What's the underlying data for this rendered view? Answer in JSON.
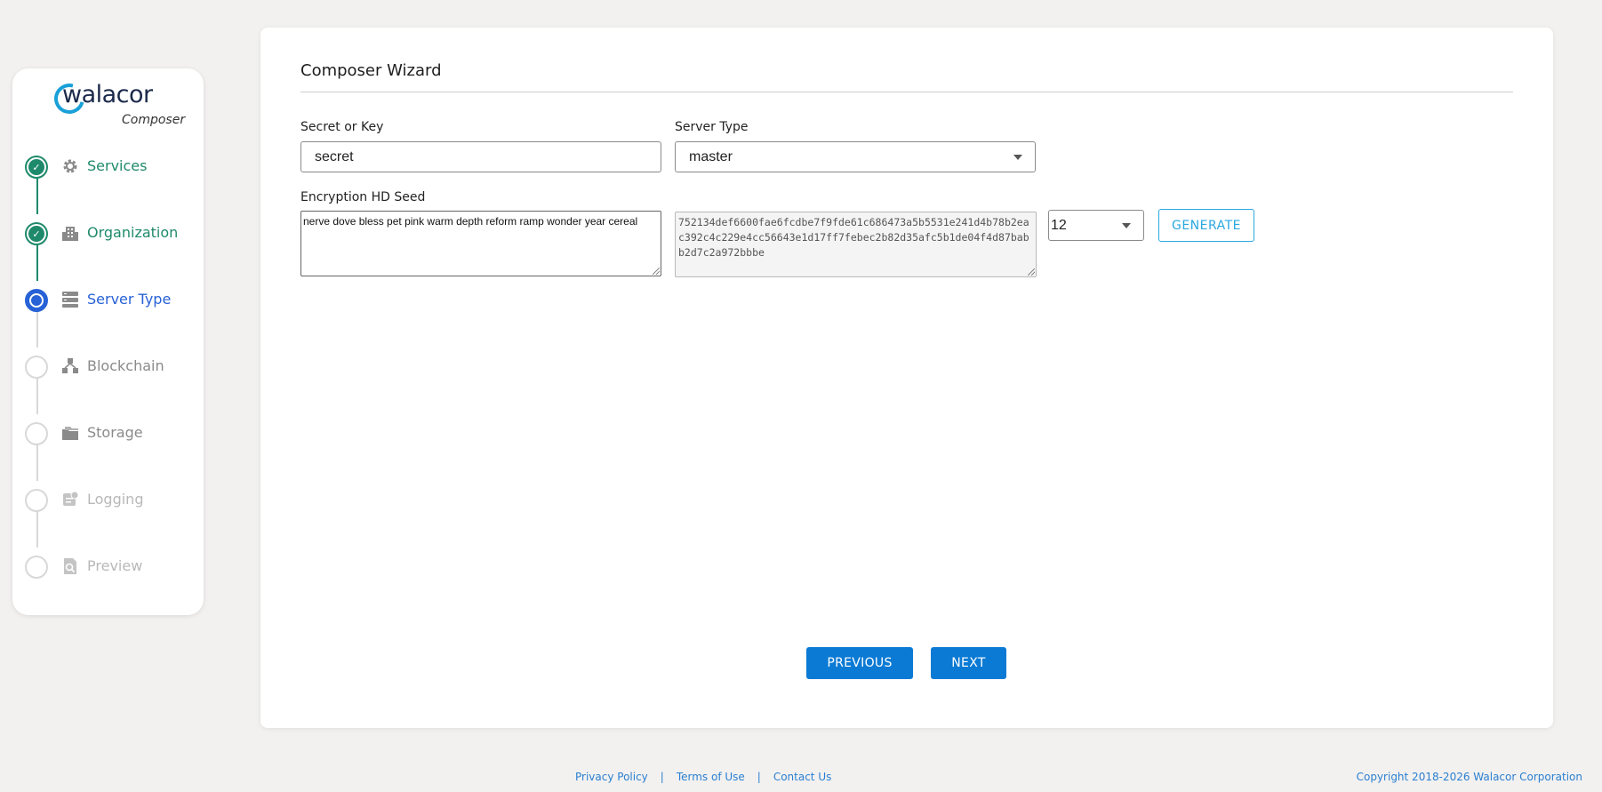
{
  "brand": {
    "logo_text": "walacor",
    "subtitle": "Composer"
  },
  "steps": [
    {
      "label": "Services",
      "status": "done",
      "icon": "gear-icon"
    },
    {
      "label": "Organization",
      "status": "done",
      "icon": "building-icon"
    },
    {
      "label": "Server Type",
      "status": "active",
      "icon": "server-icon"
    },
    {
      "label": "Blockchain",
      "status": "pending",
      "icon": "blockchain-icon"
    },
    {
      "label": "Storage",
      "status": "pending",
      "icon": "storage-icon"
    },
    {
      "label": "Logging",
      "status": "disabled",
      "icon": "logging-icon"
    },
    {
      "label": "Preview",
      "status": "disabled",
      "icon": "preview-icon"
    }
  ],
  "wizard": {
    "title": "Composer Wizard",
    "secret": {
      "label": "Secret or Key",
      "value": "secret"
    },
    "server_type": {
      "label": "Server Type",
      "value": "master"
    },
    "seed": {
      "label": "Encryption HD Seed",
      "phrase": "nerve dove bless pet pink warm depth reform ramp wonder year cereal",
      "hex": "752134def6600fae6fcdbe7f9fde61c686473a5b5531e241d4b78b2eac392c4c229e4cc56643e1d17ff7febec2b82d35afc5b1de04f4d87babb2d7c2a972bbbe",
      "word_count": "12",
      "generate_label": "GENERATE"
    },
    "previous_label": "PREVIOUS",
    "next_label": "NEXT"
  },
  "footer": {
    "privacy": "Privacy Policy",
    "terms": "Terms of Use",
    "contact": "Contact Us",
    "separator": "|",
    "copyright": "Copyright 2018-2026 Walacor Corporation"
  },
  "colors": {
    "done": "#1f8a6b",
    "active": "#2762d6",
    "primary_button": "#0a7ad4",
    "outline_button": "#2aa8e0"
  }
}
